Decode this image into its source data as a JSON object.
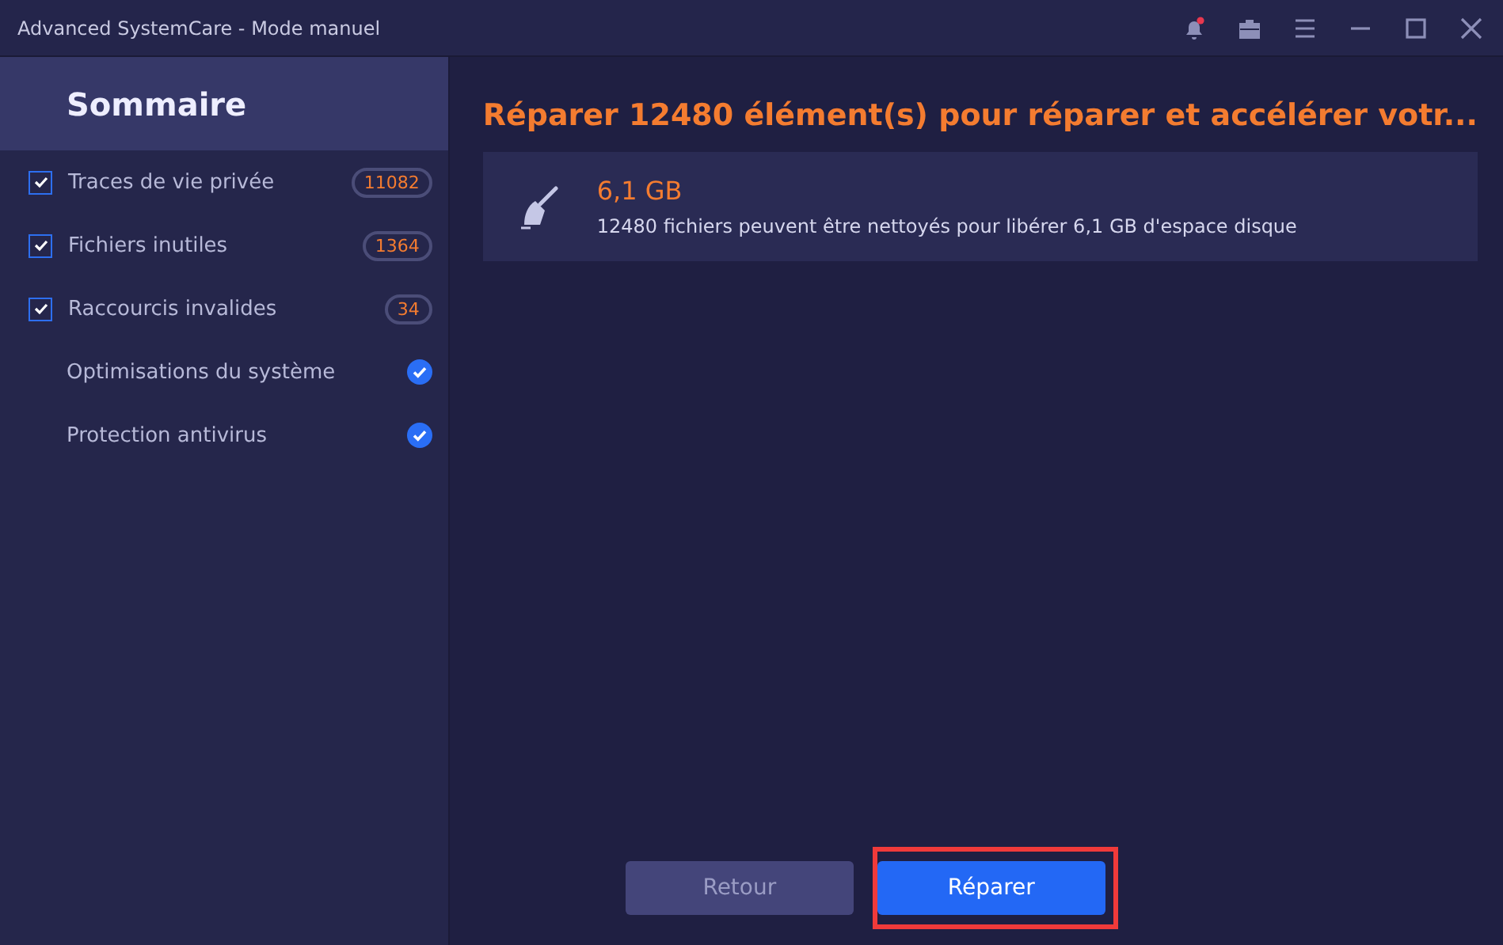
{
  "window": {
    "title": "Advanced SystemCare - Mode manuel",
    "notification": true
  },
  "sidebar": {
    "title": "Sommaire",
    "items": [
      {
        "kind": "checkbox",
        "label": "Traces de vie privée",
        "checked": true,
        "count": "11082"
      },
      {
        "kind": "checkbox",
        "label": "Fichiers inutiles",
        "checked": true,
        "count": "1364"
      },
      {
        "kind": "checkbox",
        "label": "Raccourcis invalides",
        "checked": true,
        "count": "34"
      },
      {
        "kind": "done",
        "label": "Optimisations du système"
      },
      {
        "kind": "done",
        "label": "Protection antivirus"
      }
    ]
  },
  "heading": "Réparer 12480 élément(s) pour réparer et accélérer votr...",
  "summary": {
    "size": "6,1 GB",
    "description": "12480 fichiers peuvent être nettoyés pour libérer 6,1 GB d'espace disque"
  },
  "buttons": [
    {
      "label": "Retour",
      "kind": "secondary",
      "highlighted": false
    },
    {
      "label": "Réparer",
      "kind": "primary",
      "highlighted": true
    }
  ]
}
